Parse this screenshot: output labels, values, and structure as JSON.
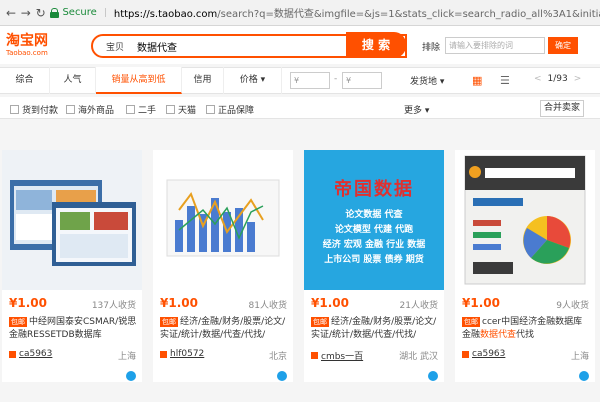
{
  "browser": {
    "secure_label": "Secure",
    "url_host": "https://s.taobao.com",
    "url_rest": "/search?q=数据代查&imgfile=&js=1&stats_click=search_radio_all%3A1&initiative_id=st"
  },
  "header": {
    "logo_cn": "淘宝网",
    "logo_en": "Taobao.com",
    "search_category": "宝贝",
    "search_query": "数据代查",
    "search_button": "搜 索",
    "sort_label": "排除",
    "sort_placeholder": "请输入要排除的词",
    "confirm_button": "确定"
  },
  "sortbar": {
    "tabs": [
      "综合",
      "人气",
      "销量从高到低",
      "信用",
      "价格 ▾"
    ],
    "price_min_placeholder": "¥",
    "price_max_placeholder": "¥",
    "price_dash": "-",
    "ship_to": "发货地 ▾",
    "pager_prev": "<",
    "pager_text": "1/93",
    "pager_next": ">"
  },
  "filters": {
    "items": [
      "货到付款",
      "海外商品",
      "二手",
      "天猫",
      "正品保障"
    ],
    "more": "更多 ▾",
    "merge_button": "合并卖家"
  },
  "products": [
    {
      "price": "¥1.00",
      "sales": "137人收货",
      "tag": "包邮",
      "title_before": "中经网国泰安CSMAR/锐思金融RESSETDB数据库",
      "title_red": "",
      "title_after": "",
      "shop": "ca5963",
      "location": "上海"
    },
    {
      "price": "¥1.00",
      "sales": "81人收货",
      "tag": "包邮",
      "title_before": "经济/金融/财务/股票/论文/实证/统计/数据/代查/代找/",
      "title_red": "",
      "title_after": "",
      "shop": "hlf0572",
      "location": "北京"
    },
    {
      "price": "¥1.00",
      "sales": "21人收货",
      "tag": "包邮",
      "title_before": "经济/金融/财务/股票/论文/实证/统计/数据/代查/代找/",
      "title_red": "",
      "title_after": "",
      "shop": "cmbs一百",
      "location": "湖北 武汉",
      "poster": {
        "headline": "帝国数据",
        "lines": [
          "论文数据 代查",
          "论文模型 代建 代跑",
          "经济 宏观 金融 行业 数据",
          "上市公司 股票 债券 期货"
        ]
      }
    },
    {
      "price": "¥1.00",
      "sales": "9人收货",
      "tag": "包邮",
      "title_before": "ccer中国经济金融数据库金融",
      "title_red": "数据代查",
      "title_after": "代找",
      "shop": "ca5963",
      "location": "上海"
    }
  ]
}
